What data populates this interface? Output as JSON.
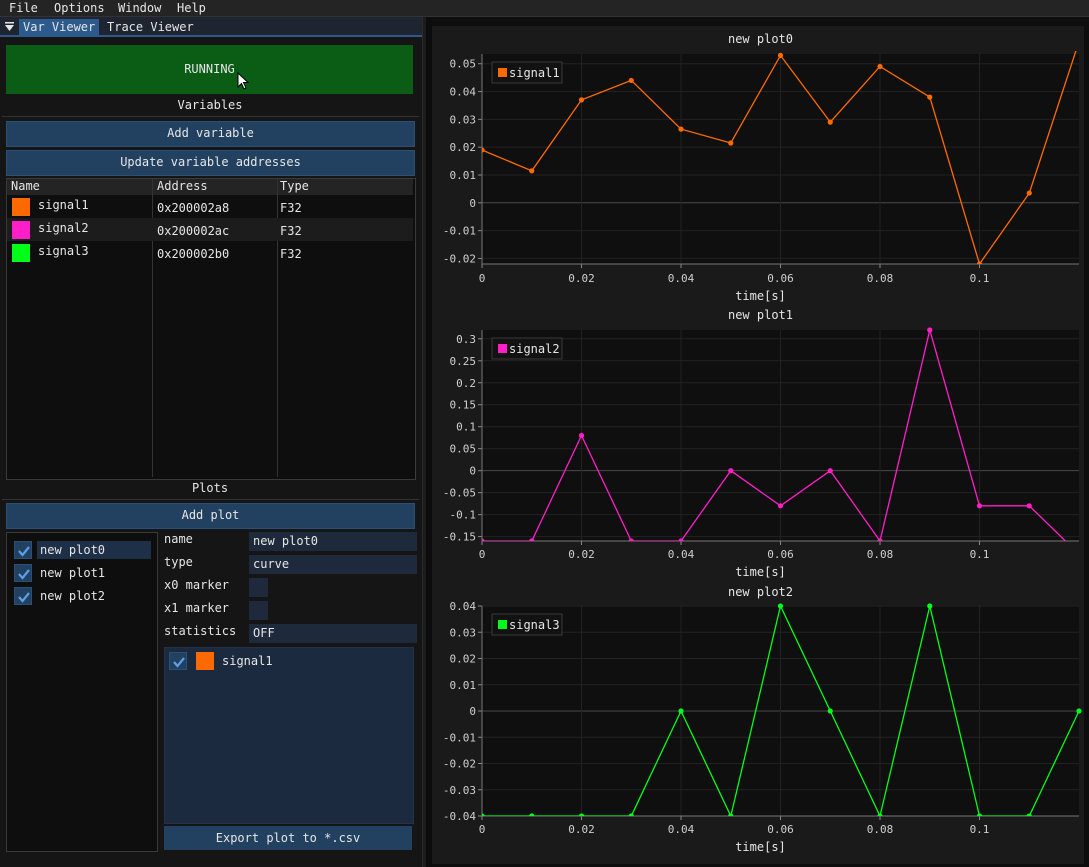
{
  "menubar": {
    "items": [
      "File",
      "Options",
      "Window",
      "Help"
    ]
  },
  "tabs": [
    {
      "label": "Var Viewer"
    },
    {
      "label": "Trace Viewer"
    }
  ],
  "status": {
    "label": "RUNNING",
    "color": "#0b5d16"
  },
  "variables": {
    "title": "Variables",
    "add_label": "Add variable",
    "update_label": "Update variable addresses",
    "columns": [
      "Name",
      "Address",
      "Type"
    ],
    "rows": [
      {
        "name": "signal1",
        "address": "0x200002a8",
        "type": "F32",
        "color": "#ff6a00"
      },
      {
        "name": "signal2",
        "address": "0x200002ac",
        "type": "F32",
        "color": "#ff1ec8"
      },
      {
        "name": "signal3",
        "address": "0x200002b0",
        "type": "F32",
        "color": "#00ff18"
      }
    ]
  },
  "plots": {
    "title": "Plots",
    "add_label": "Add plot",
    "list": [
      {
        "label": "new plot0"
      },
      {
        "label": "new plot1"
      },
      {
        "label": "new plot2"
      }
    ]
  },
  "properties": {
    "name_label": "name",
    "name_value": "new plot0",
    "type_label": "type",
    "type_value": "curve",
    "x0_label": "x0 marker",
    "x1_label": "x1 marker",
    "stats_label": "statistics",
    "stats_value": "OFF",
    "signals": [
      {
        "name": "signal1",
        "color": "#ff6a00"
      }
    ],
    "export_label": "Export plot to *.csv"
  },
  "chart_data": [
    {
      "type": "line",
      "title": "new plot0",
      "xlabel": "time[s]",
      "ylabel": "",
      "xlim": [
        0,
        0.12
      ],
      "ylim": [
        -0.022,
        0.0535
      ],
      "xticks": [
        "0",
        "0.02",
        "0.04",
        "0.06",
        "0.08",
        "0.1"
      ],
      "yticks": [
        "0.05",
        "0.04",
        "0.03",
        "0.02",
        "0.01",
        "0",
        "-0.01",
        "-0.02"
      ],
      "series": [
        {
          "name": "signal1",
          "color": "#ff6a00",
          "x": [
            0,
            0.01,
            0.02,
            0.03,
            0.04,
            0.05,
            0.06,
            0.07,
            0.08,
            0.09,
            0.1,
            0.11,
            0.12
          ],
          "y": [
            0.019,
            0.0115,
            0.037,
            0.044,
            0.0265,
            0.0215,
            0.053,
            0.029,
            0.049,
            0.038,
            -0.022,
            0.0035,
            0.058
          ]
        }
      ],
      "legend": "top-left",
      "grid": true
    },
    {
      "type": "line",
      "title": "new plot1",
      "xlabel": "time[s]",
      "ylabel": "",
      "xlim": [
        0,
        0.12
      ],
      "ylim": [
        -0.16,
        0.32
      ],
      "xticks": [
        "0",
        "0.02",
        "0.04",
        "0.06",
        "0.08",
        "0.1"
      ],
      "yticks": [
        "0.3",
        "0.25",
        "0.2",
        "0.15",
        "0.1",
        "0.05",
        "0",
        "-0.05",
        "-0.1",
        "-0.15"
      ],
      "series": [
        {
          "name": "signal2",
          "color": "#ff1ec8",
          "x": [
            0,
            0.01,
            0.02,
            0.03,
            0.04,
            0.05,
            0.06,
            0.07,
            0.08,
            0.09,
            0.1,
            0.11,
            0.12
          ],
          "y": [
            -0.16,
            -0.16,
            0.08,
            -0.16,
            -0.16,
            0,
            -0.08,
            0,
            -0.16,
            0.32,
            -0.08,
            -0.08,
            -0.19
          ]
        }
      ],
      "legend": "top-left",
      "grid": true
    },
    {
      "type": "line",
      "title": "new plot2",
      "xlabel": "time[s]",
      "ylabel": "",
      "xlim": [
        0,
        0.12
      ],
      "ylim": [
        -0.04,
        0.04
      ],
      "xticks": [
        "0",
        "0.02",
        "0.04",
        "0.06",
        "0.08",
        "0.1"
      ],
      "yticks": [
        "0.04",
        "0.03",
        "0.02",
        "0.01",
        "0",
        "-0.01",
        "-0.02",
        "-0.03",
        "-0.04"
      ],
      "series": [
        {
          "name": "signal3",
          "color": "#00ff18",
          "x": [
            0,
            0.01,
            0.02,
            0.03,
            0.04,
            0.05,
            0.06,
            0.07,
            0.08,
            0.09,
            0.1,
            0.11,
            0.12
          ],
          "y": [
            -0.04,
            -0.04,
            -0.04,
            -0.04,
            0,
            -0.04,
            0.04,
            0,
            -0.04,
            0.04,
            -0.04,
            -0.04,
            0
          ]
        }
      ],
      "legend": "top-left",
      "grid": true
    }
  ]
}
